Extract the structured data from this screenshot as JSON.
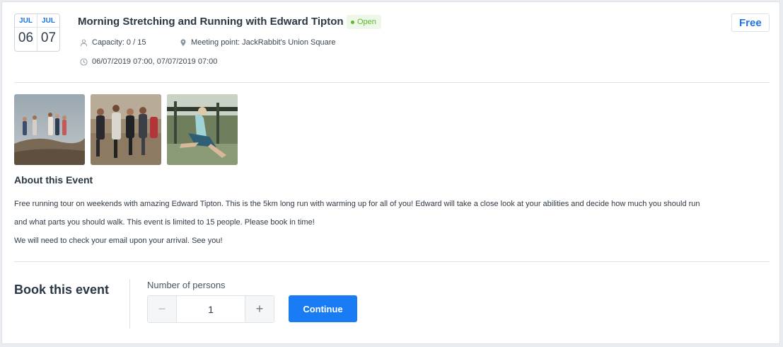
{
  "event": {
    "date": {
      "start": {
        "month": "JUL",
        "day": "06"
      },
      "end": {
        "month": "JUL",
        "day": "07"
      }
    },
    "title": "Morning Stretching and Running with Edward Tipton",
    "status": "Open",
    "price": "Free",
    "capacity": "Capacity: 0 / 15",
    "meeting_point": "Meeting point: JackRabbit's Union Square",
    "datetime": "06/07/2019 07:00, 07/07/2019 07:00"
  },
  "about": {
    "heading": "About this Event",
    "lines": [
      "Free running tour on weekends with amazing Edward Tipton. This is the 5km long run with warming up for all of you! Edward will take a close look at your abilities and decide how much you should run",
      "and what parts you should walk. This event is limited to 15 people. Please book in time!",
      "We will need to check your email upon your arrival. See you!"
    ]
  },
  "booking": {
    "heading": "Book this event",
    "persons_label": "Number of persons",
    "persons_value": "1",
    "minus_symbol": "−",
    "plus_symbol": "+",
    "continue_label": "Continue"
  },
  "colors": {
    "accent": "#1a73e8",
    "button": "#1a7cf5",
    "status": "#5fb82f"
  }
}
